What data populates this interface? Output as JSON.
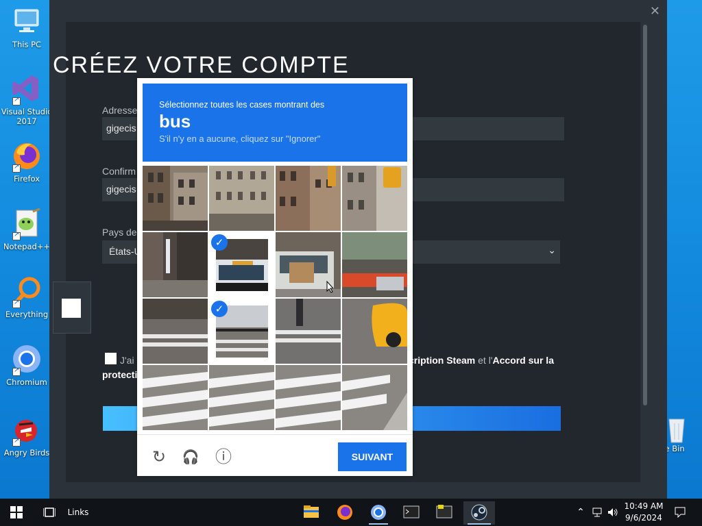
{
  "desktop": {
    "icons": [
      {
        "label": "This PC"
      },
      {
        "label": "Visual Studio\n2017"
      },
      {
        "label": "Firefox"
      },
      {
        "label": "Notepad++"
      },
      {
        "label": "Everything"
      },
      {
        "label": "Chromium"
      },
      {
        "label": "Angry Birds"
      },
      {
        "label": "cle Bin"
      }
    ]
  },
  "steam": {
    "title": "CRÉEZ VOTRE COMPTE",
    "close_glyph": "✕",
    "email_label": "Adresse",
    "email_value": "gigecis",
    "confirm_label": "Confirm",
    "confirm_value": "gigecis",
    "country_label": "Pays de",
    "country_value": "États-U",
    "terms_prefix": "J'ai",
    "terms_mid": "cription Steam",
    "terms_and": " et l'",
    "terms_accord": "Accord sur la",
    "terms_line2": "protecti"
  },
  "captcha": {
    "instruction": "Sélectionnez toutes les cases montrant des",
    "keyword": "bus",
    "hint": "S'il n'y en a aucune, cliquez sur \"Ignorer\"",
    "next_label": "SUIVANT",
    "selected_tiles": [
      5,
      9
    ],
    "check_glyph": "✓",
    "reload_glyph": "↻",
    "audio_glyph": "🎧",
    "info_glyph": "ⓘ"
  },
  "taskbar": {
    "links_label": "Links",
    "time": "10:49 AM",
    "date": "9/6/2024"
  }
}
